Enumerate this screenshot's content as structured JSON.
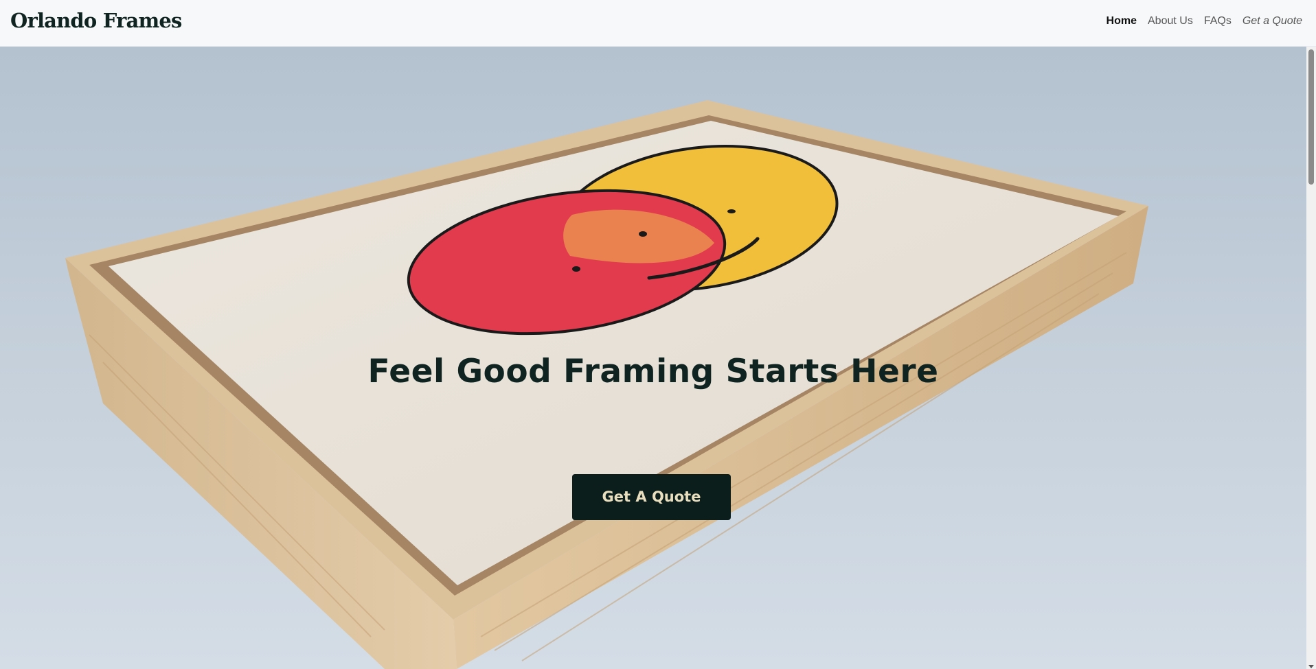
{
  "brand": {
    "name": "Orlando Frames"
  },
  "nav": {
    "items": [
      {
        "label": "Home"
      },
      {
        "label": "About Us"
      },
      {
        "label": "FAQs"
      },
      {
        "label": "Get a Quote"
      }
    ]
  },
  "hero": {
    "headline": "Feel Good Framing Starts Here",
    "cta_label": "Get A Quote"
  },
  "colors": {
    "nav_background": "#f7f8fa",
    "text_dark": "#0f2320",
    "button_background": "#0b1e1c",
    "button_text": "#e9dfbf",
    "art_red": "#e23b4e",
    "art_yellow": "#f1bf3a",
    "art_orange": "#ea8650",
    "frame_wood": "#d9bc94"
  }
}
